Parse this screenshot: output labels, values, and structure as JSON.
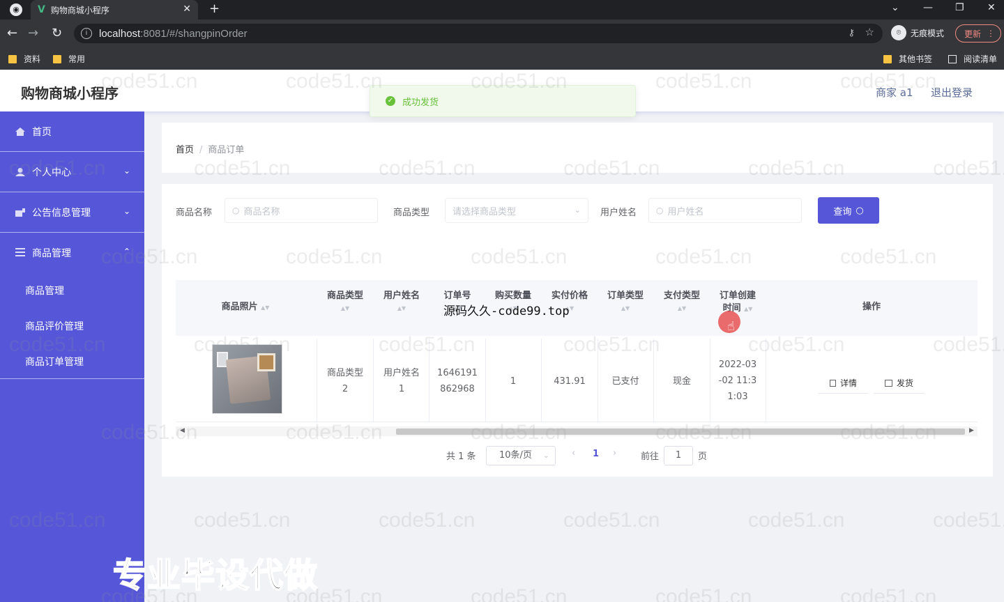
{
  "browser": {
    "tab_title": "购物商城小程序",
    "tab_logo": "V",
    "url_host": "localhost",
    "url_path": ":8081/#/shangpinOrder",
    "incognito_label": "无痕模式",
    "update_label": "更新",
    "bookmarks": [
      "资料",
      "常用"
    ],
    "other_bookmarks": "其他书签",
    "reading_list": "阅读清单"
  },
  "app": {
    "title": "购物商城小程序",
    "merchant": "商家 a1",
    "logout": "退出登录"
  },
  "toast": "成功发货",
  "sidebar": {
    "items": [
      {
        "label": "首页"
      },
      {
        "label": "个人中心"
      },
      {
        "label": "公告信息管理"
      },
      {
        "label": "商品管理"
      }
    ],
    "sub_items": [
      "商品管理",
      "商品评价管理",
      "商品订单管理"
    ]
  },
  "breadcrumb": {
    "home": "首页",
    "sep": "/",
    "current": "商品订单"
  },
  "search": {
    "name_label": "商品名称",
    "name_placeholder": "商品名称",
    "type_label": "商品类型",
    "type_placeholder": "请选择商品类型",
    "user_label": "用户姓名",
    "user_placeholder": "用户姓名",
    "query_button": "查询"
  },
  "table": {
    "headers": [
      "商品照片",
      "商品类型",
      "用户姓名",
      "订单号",
      "购买数量",
      "实付价格",
      "订单类型",
      "支付类型",
      "订单创建时间",
      "操作"
    ],
    "header_time_lines": [
      "订单创建",
      "时间"
    ],
    "row": {
      "type_lines": [
        "商品类型",
        "2"
      ],
      "user_lines": [
        "用户姓名",
        "1"
      ],
      "order_lines": [
        "1646191",
        "862968"
      ],
      "quantity": "1",
      "price": "431.91",
      "order_type": "已支付",
      "pay_type": "现金",
      "time_lines": [
        "2022-03",
        "-02 11:3",
        "1:03"
      ]
    },
    "actions": {
      "detail": "详情",
      "ship": "发货"
    }
  },
  "pager": {
    "total": "共 1 条",
    "page_size": "10条/页",
    "current": "1",
    "goto": "前往",
    "goto_value": "1",
    "unit": "页"
  },
  "watermark": "code51.cn",
  "overlay_text": "源码久久-code99.top",
  "banner_text": "专业毕设代做",
  "colors": {
    "sidebar": "#5557d8",
    "primary": "#5557d8",
    "success": "#67c23a"
  }
}
